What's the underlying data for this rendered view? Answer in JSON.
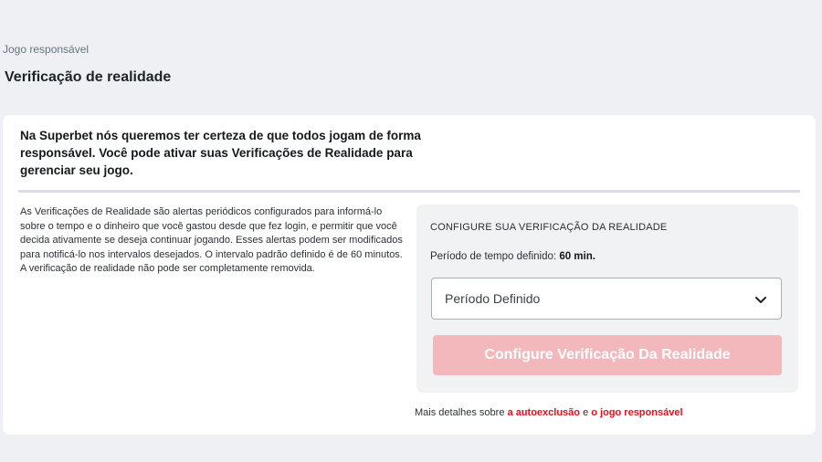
{
  "breadcrumb": "Jogo responsável",
  "page_title": "Verificação de realidade",
  "intro_text": "Na Superbet nós queremos ter certeza de que todos jogam de forma responsável. Você pode ativar suas Verificações de Realidade para gerenciar seu jogo.",
  "description": "As Verificações de Realidade são alertas periódicos configurados para informá-lo sobre o tempo e o dinheiro que você gastou desde que fez login, e permitir que você decida ativamente se deseja continuar jogando. Esses alertas podem ser modificados para notificá-lo nos intervalos desejados. O intervalo padrão definido é de 60 minutos. A verificação de realidade não pode ser completamente removida.",
  "config": {
    "title": "CONFIGURE SUA VERIFICAÇÃO DA REALIDADE",
    "period_label": "Período de tempo definido:",
    "period_value": "60 min.",
    "select_value": "Período Definido",
    "button_label": "Configure Verificação Da Realidade"
  },
  "footer": {
    "prefix": "Mais detalhes sobre",
    "link1": "a autoexclusão",
    "connector": "e",
    "link2": "o jogo responsável"
  },
  "colors": {
    "accent": "#e3111e",
    "button_disabled": "#f2b8bb"
  }
}
